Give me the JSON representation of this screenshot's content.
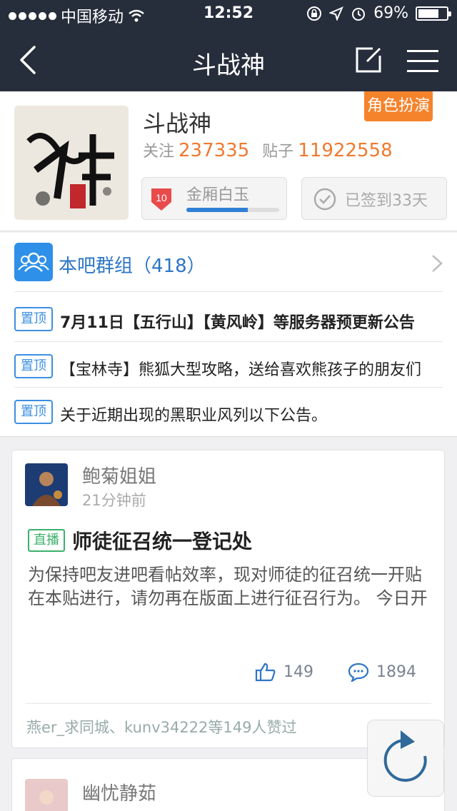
{
  "status_bar": {
    "carrier": "中国移动",
    "time": "12:52",
    "battery": "69%"
  },
  "nav": {
    "title": "斗战神"
  },
  "forum": {
    "name": "斗战神",
    "role_badge": "角色扮演",
    "follow_label": "关注",
    "follow_count": "237335",
    "posts_label": "贴子",
    "posts_count": "11922558",
    "level_number": "10",
    "level_title": "金厢白玉",
    "level_progress": 0.66,
    "sign_label": "已签到33天"
  },
  "group": {
    "label": "本吧群组（418）"
  },
  "pinned": [
    {
      "tag": "置顶",
      "text": "7月11日【五行山】【黄风岭】等服务器预更新公告"
    },
    {
      "tag": "置顶",
      "text": "【宝林寺】熊狐大型攻略，送给喜欢熊孩子的朋友们"
    },
    {
      "tag": "置顶",
      "text": "关于近期出现的黑职业风列以下公告。"
    }
  ],
  "post": {
    "author": "鲍菊姐姐",
    "time": "21分钟前",
    "tag": "直播",
    "title": "师徒征召统一登记处",
    "body": "为保持吧友进吧看帖效率，现对师徒的征召统一开贴在本贴进行，请勿再在版面上进行征召行为。 今日开",
    "likes": "149",
    "comments": "1894",
    "liked_by": "燕er_求同城、kunv34222等149人赞过"
  },
  "post2": {
    "author": "幽忧静茹"
  },
  "colors": {
    "nav_bg": "#262d3b",
    "accent_orange": "#f0792f",
    "accent_blue": "#2e76c6",
    "live_green": "#3bb06a"
  }
}
